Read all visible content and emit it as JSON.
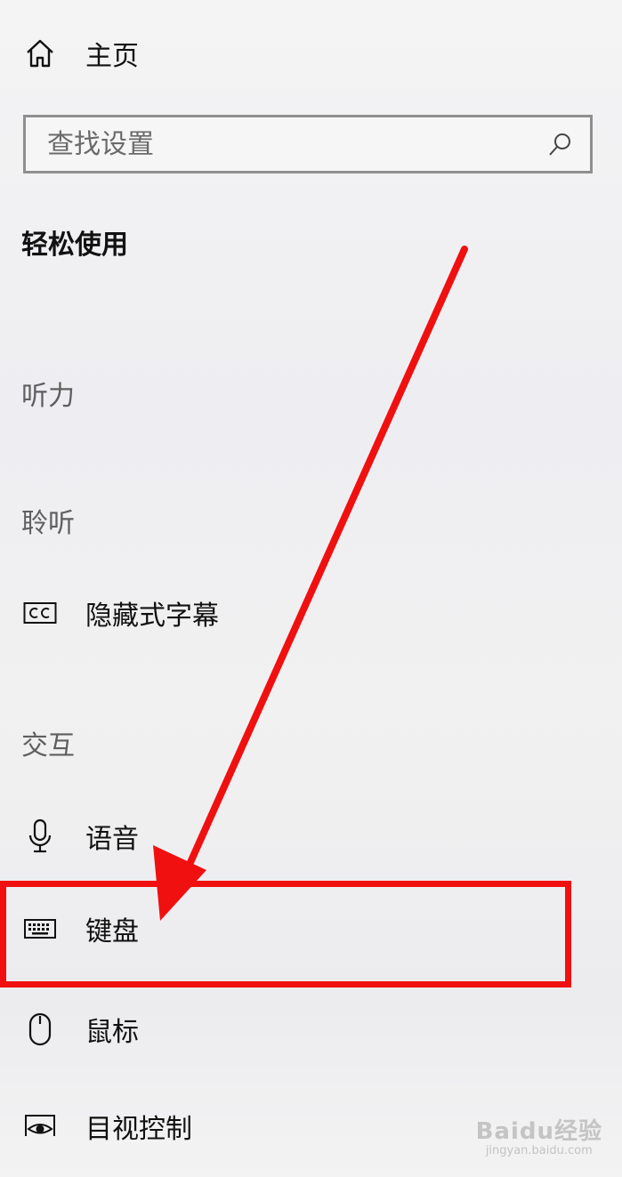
{
  "nav": {
    "home_label": "主页"
  },
  "search": {
    "placeholder": "查找设置"
  },
  "section_title": "轻松使用",
  "groups": {
    "hearing": "听力",
    "listening": "聆听",
    "interaction": "交互"
  },
  "items": {
    "closed_captions": "隐藏式字幕",
    "speech": "语音",
    "keyboard": "键盘",
    "mouse": "鼠标",
    "eye_control": "目视控制"
  },
  "icons": {
    "home": "home-icon",
    "search": "search-icon",
    "closed_captions": "closed-captions-icon",
    "speech": "microphone-icon",
    "keyboard": "keyboard-icon",
    "mouse": "mouse-icon",
    "eye_control": "eye-icon"
  },
  "annotation": {
    "color": "#f01010"
  },
  "watermark": {
    "brand": "Baidu经验",
    "url": "jingyan.baidu.com"
  }
}
